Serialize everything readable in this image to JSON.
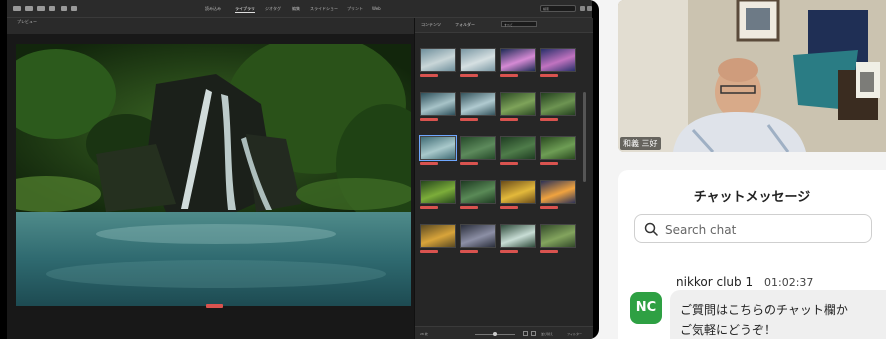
{
  "editor": {
    "top_menu": [
      "読み込み",
      "ライブラリ",
      "ジオタグ",
      "編集",
      "スライドショー",
      "プリント",
      "Web"
    ],
    "active_tab": "ライブラリ",
    "top_search_placeholder": "検索",
    "panel_title": "コンテンツ",
    "panel_subtitle": "フォルダー",
    "panel_filter": "すべて",
    "preview_label": "プレビュー",
    "footer_count": "28 枚",
    "footer_sort": "並び替え",
    "footer_filter": "フィルター"
  },
  "camera": {
    "participant_name": "和義 三好"
  },
  "chat": {
    "title": "チャットメッセージ",
    "search_placeholder": "Search chat",
    "messages": [
      {
        "sender": "nikkor club 1",
        "time": "01:02:37",
        "avatar_initials": "NC",
        "avatar_color": "#2ea043",
        "line1": "ご質問はこちらのチャット欄か",
        "line2": "ご気軽にどうぞ！"
      }
    ]
  },
  "colors": {
    "accent_red": "#d9534f",
    "chat_avatar_green": "#2ea043"
  }
}
